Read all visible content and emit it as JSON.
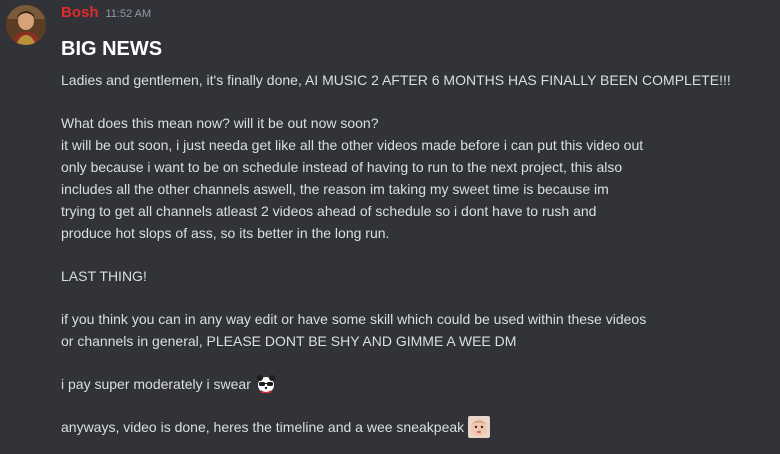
{
  "message": {
    "author": "Bosh",
    "author_color": "#e02b2b",
    "timestamp": "11:52 AM",
    "headline": "BIG NEWS",
    "para1": "Ladies and gentlemen, it's finally done, AI MUSIC 2 AFTER 6 MONTHS HAS FINALLY BEEN COMPLETE!!!",
    "para2": [
      "What does this mean now? will it be out now soon?",
      "it will be out soon, i just needa get like all the other videos made before i can put this video out",
      "only because i want to be on schedule instead of having to run to the next project, this also",
      "includes all the other channels aswell, the reason im taking my sweet time is because im",
      "trying to get all channels atleast 2 videos ahead of schedule so i dont have to rush and",
      "produce hot slops of ass, so its better in the long run."
    ],
    "para3": "LAST THING!",
    "para4": [
      "if you think you can in any way edit or have some skill which could be used within these videos",
      "or channels in general, PLEASE DONT BE SHY AND GIMME A WEE DM"
    ],
    "para5": "i pay super moderately i swear",
    "para5_emoji": "panda-sunglasses-emoji",
    "para6": "anyways, video is done, heres the timeline and a wee sneakpeak",
    "para6_emoji": "baby-face-emoji"
  }
}
